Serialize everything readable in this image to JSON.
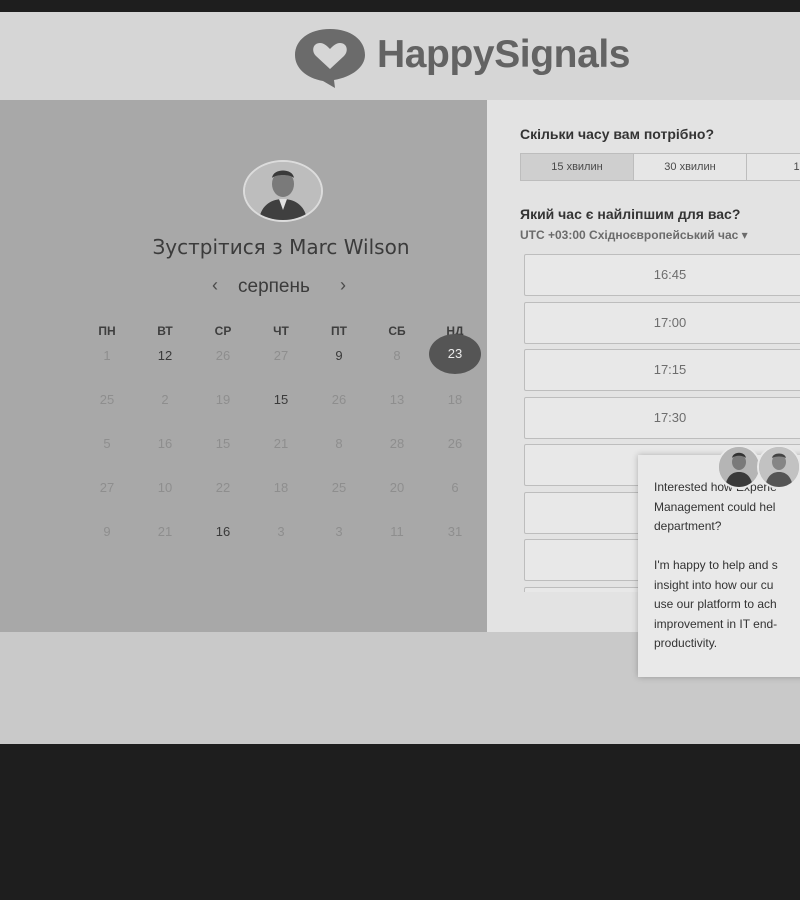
{
  "brand": {
    "name": "HappySignals"
  },
  "scheduler": {
    "title": "Зустрітися з Marc Wilson",
    "month": "серпень",
    "weekdays": [
      "ПН",
      "ВТ",
      "СР",
      "ЧТ",
      "ПТ",
      "СБ",
      "НД"
    ],
    "weeks": [
      [
        "1",
        "12",
        "26",
        "27",
        "9",
        "8",
        "23"
      ],
      [
        "25",
        "2",
        "19",
        "15",
        "26",
        "13",
        "18"
      ],
      [
        "5",
        "16",
        "15",
        "21",
        "8",
        "28",
        "26"
      ],
      [
        "27",
        "10",
        "22",
        "18",
        "25",
        "20",
        "6"
      ],
      [
        "9",
        "21",
        "16",
        "3",
        "3",
        "11",
        "31"
      ]
    ],
    "available_days": [
      "12",
      "9",
      "15",
      "16"
    ],
    "selected_day": "23"
  },
  "duration": {
    "question": "Скільки часу вам потрібно?",
    "options": [
      "15 хвилин",
      "30 хвилин",
      "1 го"
    ],
    "active_index": 0
  },
  "time": {
    "question": "Який час є найліпшим для вас?",
    "timezone": "UTC +03:00 Східноєвропейський час ▾",
    "slots": [
      "16:45",
      "17:00",
      "17:15",
      "17:30",
      "",
      "",
      "",
      ""
    ]
  },
  "chat": {
    "message": "Interested how Experie\nManagement could hel\ndepartment?\n\nI'm happy to help and s\ninsight into how our cu\nuse our platform to ach\nimprovement in IT end-\nproductivity."
  },
  "colors": {
    "selected_day_bg": "#555555",
    "left_panel_bg": "#a8a8a8",
    "right_panel_bg": "#e3e3e3"
  }
}
